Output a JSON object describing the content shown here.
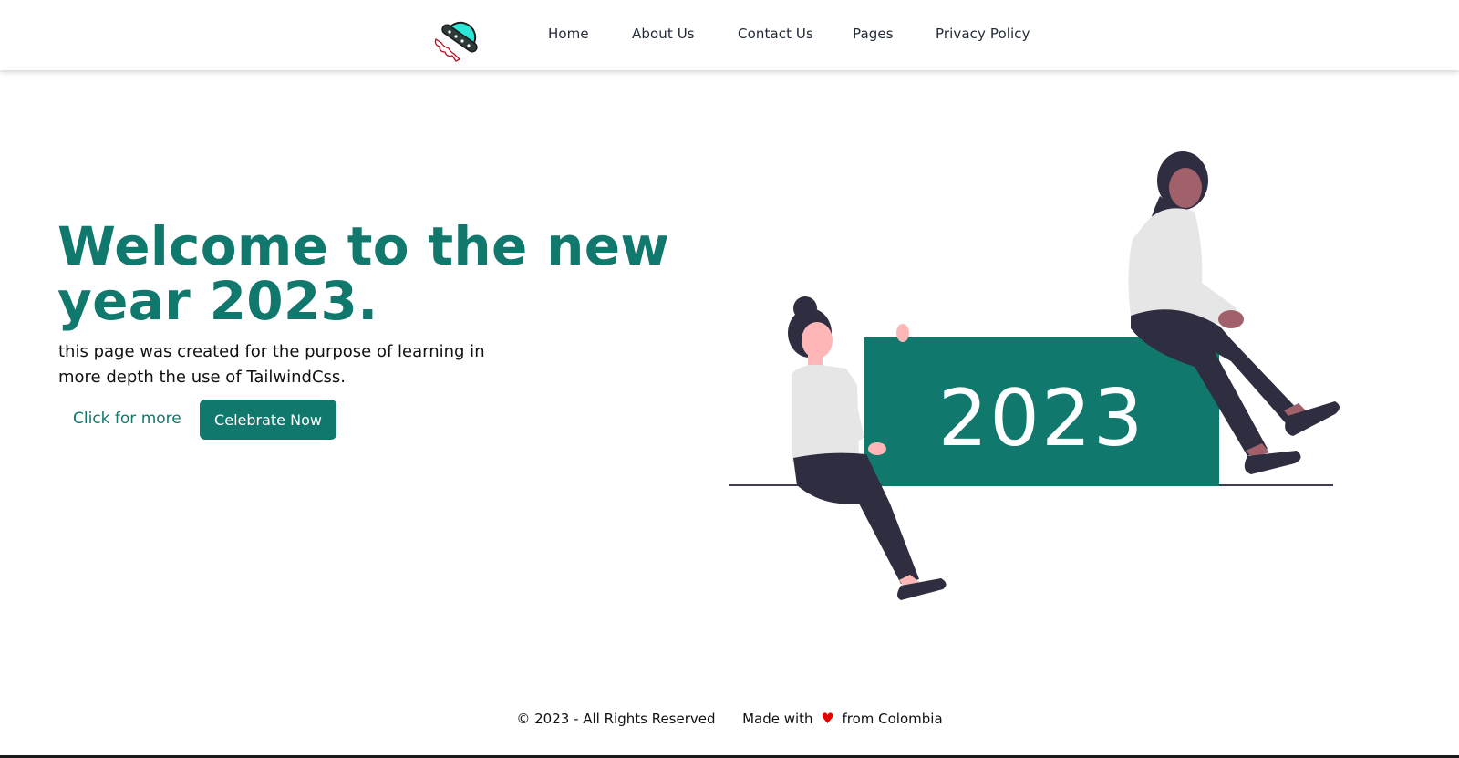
{
  "header": {
    "logo_icon": "ufo-icon",
    "nav": [
      {
        "label": "Home"
      },
      {
        "label": "About Us"
      },
      {
        "label": "Contact Us"
      },
      {
        "label": "Pages"
      },
      {
        "label": "Privacy Policy"
      }
    ]
  },
  "hero": {
    "title": "Welcome to the new year 2023.",
    "description": "this page was created for the purpose of learning in more depth the use of TailwindCss.",
    "secondary_button": "Click for more",
    "primary_button": "Celebrate Now",
    "illustration": {
      "sign_text": "2023",
      "icon": "two-women-with-2023-sign-illustration"
    }
  },
  "footer": {
    "copyright": "© 2023 - All Rights Reserved",
    "made_with_prefix": "Made with",
    "heart_icon": "heart-icon",
    "made_with_suffix": "from Colombia"
  },
  "colors": {
    "brand": "#11786e",
    "ufo_dome": "#2ee6d6",
    "heart": "#e50000",
    "dark": "#2f2e41",
    "skin_light": "#ffb6b6",
    "skin_dark": "#a0616a",
    "shirt": "#e6e6e6"
  }
}
